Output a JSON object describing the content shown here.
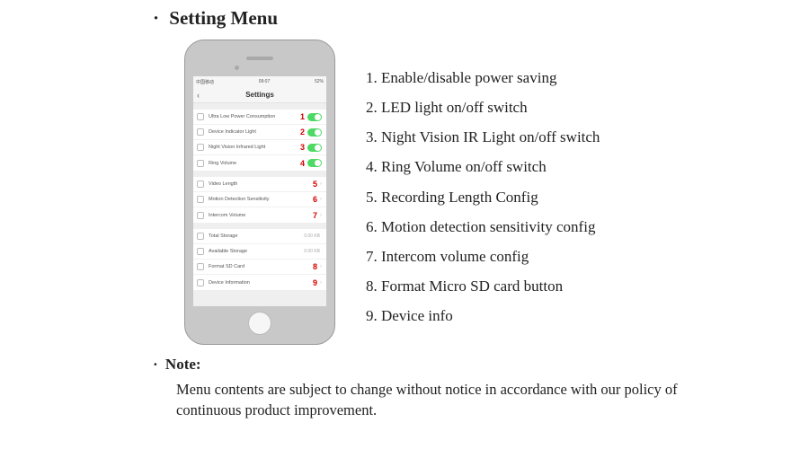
{
  "heading": "Setting Menu",
  "phone": {
    "statusbar": {
      "left": "中国移动",
      "center": "09:07",
      "right": "52%"
    },
    "navtitle": "Settings",
    "groups": [
      [
        {
          "label": "Ultra Low Power Consumption",
          "num": "1",
          "type": "toggle"
        },
        {
          "label": "Device Indicator Light",
          "num": "2",
          "type": "toggle"
        },
        {
          "label": "Night Vision Infrared Light",
          "num": "3",
          "type": "toggle"
        },
        {
          "label": "Ring Volume",
          "num": "4",
          "type": "toggle"
        }
      ],
      [
        {
          "label": "Video Length",
          "num": "5",
          "type": "disclosure"
        },
        {
          "label": "Motion Detection Sensitivity",
          "num": "6",
          "type": "disclosure"
        },
        {
          "label": "Intercom Volume",
          "num": "7",
          "type": "disclosure"
        }
      ],
      [
        {
          "label": "Total Storage",
          "num": "",
          "type": "value",
          "value": "0.00 KB"
        },
        {
          "label": "Available Storage",
          "num": "",
          "type": "value",
          "value": "0.00 KB"
        },
        {
          "label": "Format SD Card",
          "num": "8",
          "type": "disclosure"
        },
        {
          "label": "Device Information",
          "num": "9",
          "type": "disclosure"
        }
      ]
    ]
  },
  "legend": [
    "1. Enable/disable power saving",
    "2. LED light on/off switch",
    "3. Night Vision IR Light on/off switch",
    "4. Ring Volume on/off switch",
    "5. Recording Length Config",
    "6. Motion detection sensitivity config",
    "7. Intercom volume config",
    "8. Format Micro SD card button",
    "9. Device info"
  ],
  "note": {
    "heading": "Note:",
    "body": "Menu contents are subject to change without notice in accordance with our policy of continuous product improvement."
  }
}
